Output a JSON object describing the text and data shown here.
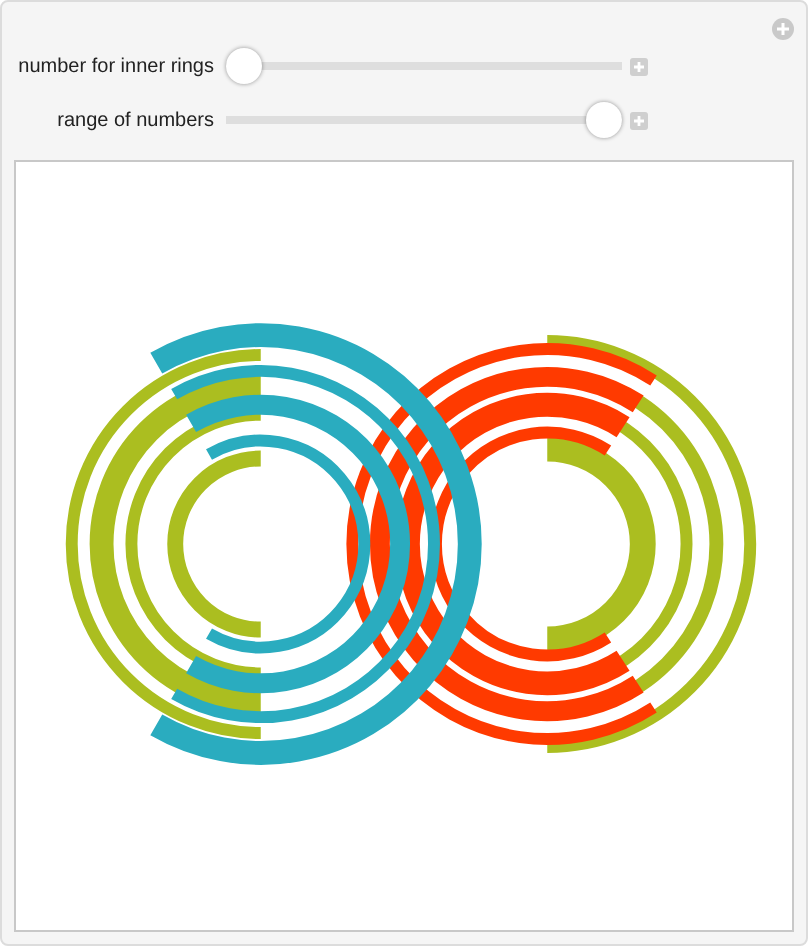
{
  "controls": [
    {
      "label": "number for inner rings",
      "level": 0
    },
    {
      "label": "range of numbers",
      "level": 1
    }
  ]
}
